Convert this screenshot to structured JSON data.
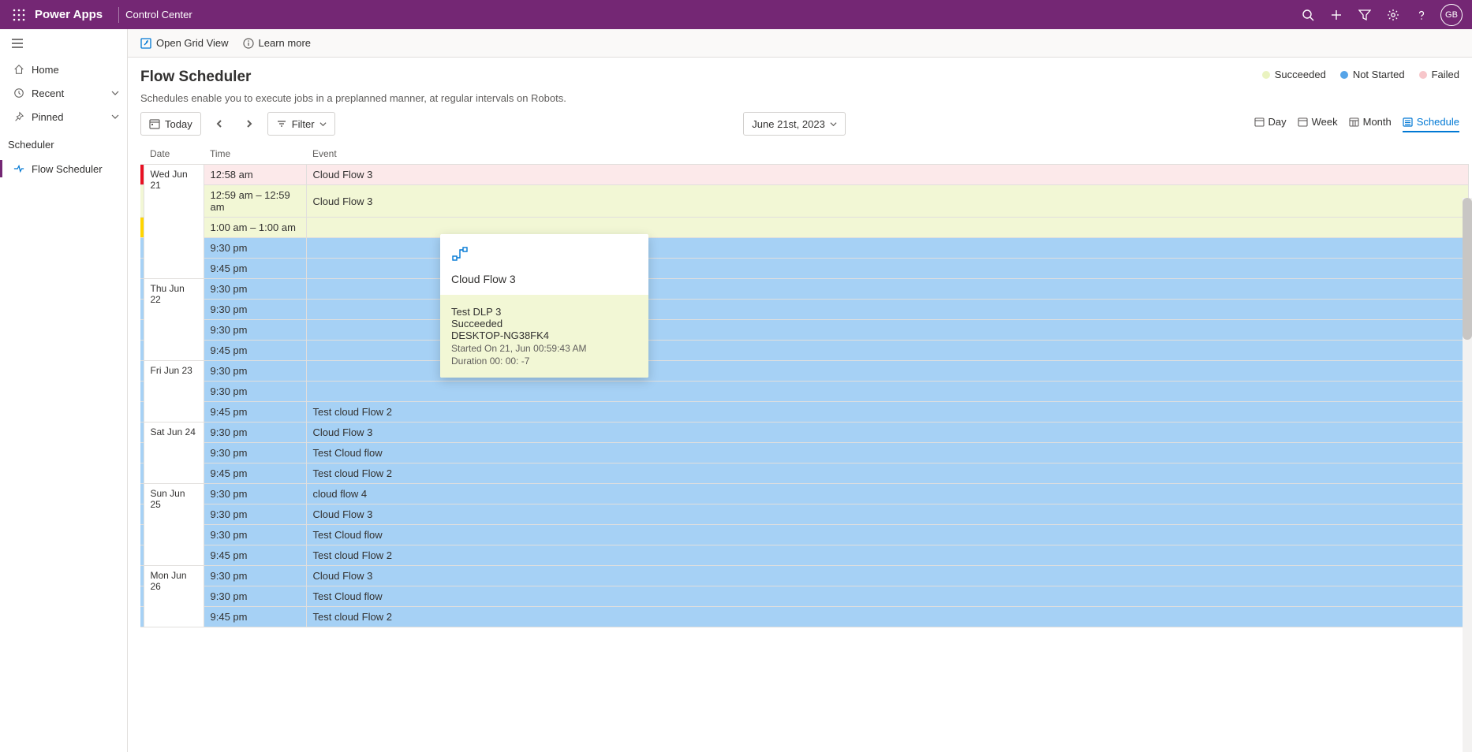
{
  "header": {
    "app_name": "Power Apps",
    "sub_title": "Control Center",
    "avatar_initials": "GB"
  },
  "sidebar": {
    "items": [
      "Home",
      "Recent",
      "Pinned"
    ],
    "section_label": "Scheduler",
    "active_item": "Flow Scheduler"
  },
  "cmd": {
    "open_grid": "Open Grid View",
    "learn_more": "Learn more"
  },
  "page": {
    "title": "Flow Scheduler",
    "desc": "Schedules enable you to execute jobs in a preplanned manner, at regular intervals on Robots."
  },
  "legend": {
    "succeeded": "Succeeded",
    "not_started": "Not Started",
    "failed": "Failed"
  },
  "colors": {
    "succeeded": "#eaf3c0",
    "not_started": "#56a4e8",
    "failed": "#f7c6ca"
  },
  "toolbar": {
    "today": "Today",
    "filter": "Filter",
    "date": "June 21st, 2023",
    "views": {
      "day": "Day",
      "week": "Week",
      "month": "Month",
      "schedule": "Schedule"
    }
  },
  "columns": {
    "date": "Date",
    "time": "Time",
    "event": "Event"
  },
  "rows": [
    {
      "date": "Wed Jun 21",
      "bar": "#e81123",
      "items": [
        {
          "time": "12:58 am",
          "event": "Cloud Flow 3",
          "status": "failed"
        },
        {
          "time": "12:59 am – 12:59 am",
          "event": "Cloud Flow 3",
          "status": "succeeded"
        },
        {
          "time": "1:00 am – 1:00 am",
          "event": "",
          "status": "succeeded",
          "bar": "#ffd500"
        },
        {
          "time": "9:30 pm",
          "event": "",
          "status": "notstarted"
        },
        {
          "time": "9:45 pm",
          "event": "",
          "status": "notstarted"
        }
      ]
    },
    {
      "date": "Thu Jun 22",
      "items": [
        {
          "time": "9:30 pm",
          "event": "",
          "status": "notstarted"
        },
        {
          "time": "9:30 pm",
          "event": "",
          "status": "notstarted"
        },
        {
          "time": "9:30 pm",
          "event": "",
          "status": "notstarted"
        },
        {
          "time": "9:45 pm",
          "event": "",
          "status": "notstarted"
        }
      ]
    },
    {
      "date": "Fri Jun 23",
      "items": [
        {
          "time": "9:30 pm",
          "event": "",
          "status": "notstarted"
        },
        {
          "time": "9:30 pm",
          "event": "",
          "status": "notstarted"
        },
        {
          "time": "9:45 pm",
          "event": "Test cloud Flow 2",
          "status": "notstarted"
        }
      ]
    },
    {
      "date": "Sat Jun 24",
      "items": [
        {
          "time": "9:30 pm",
          "event": "Cloud Flow 3",
          "status": "notstarted"
        },
        {
          "time": "9:30 pm",
          "event": "Test Cloud flow",
          "status": "notstarted"
        },
        {
          "time": "9:45 pm",
          "event": "Test cloud Flow 2",
          "status": "notstarted"
        }
      ]
    },
    {
      "date": "Sun Jun 25",
      "items": [
        {
          "time": "9:30 pm",
          "event": "cloud flow 4",
          "status": "notstarted"
        },
        {
          "time": "9:30 pm",
          "event": "Cloud Flow 3",
          "status": "notstarted"
        },
        {
          "time": "9:30 pm",
          "event": "Test Cloud flow",
          "status": "notstarted"
        },
        {
          "time": "9:45 pm",
          "event": "Test cloud Flow 2",
          "status": "notstarted"
        }
      ]
    },
    {
      "date": "Mon Jun 26",
      "items": [
        {
          "time": "9:30 pm",
          "event": "Cloud Flow 3",
          "status": "notstarted"
        },
        {
          "time": "9:30 pm",
          "event": "Test Cloud flow",
          "status": "notstarted"
        },
        {
          "time": "9:45 pm",
          "event": "Test cloud Flow 2",
          "status": "notstarted"
        }
      ]
    }
  ],
  "popup": {
    "title": "Cloud Flow 3",
    "line1": "Test DLP 3",
    "line2": "Succeeded",
    "line3": "DESKTOP-NG38FK4",
    "line4": "Started On 21, Jun 00:59:43 AM",
    "line5": "Duration 00: 00: -7"
  }
}
